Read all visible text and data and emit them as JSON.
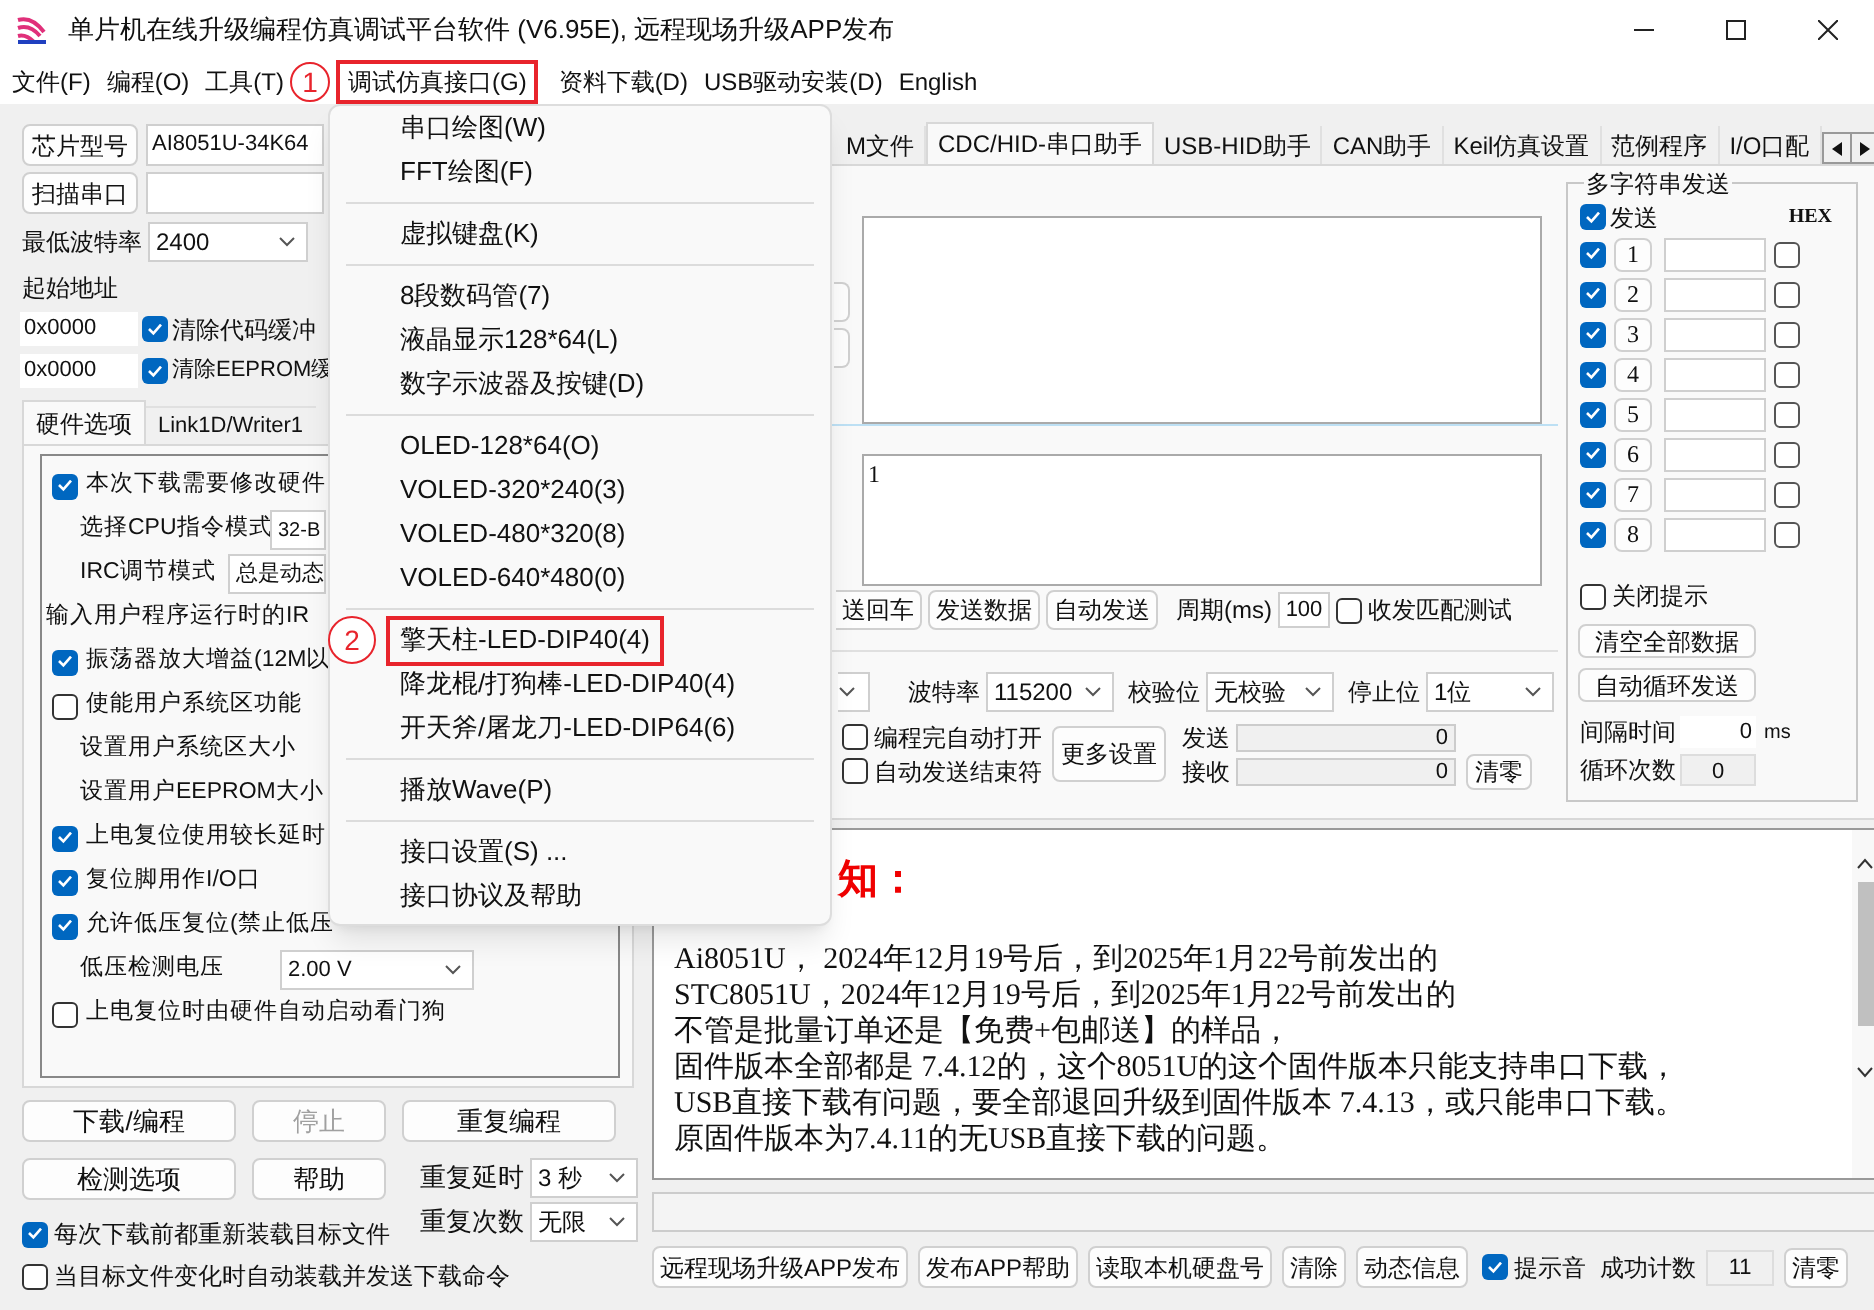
{
  "window": {
    "title": "单片机在线升级编程仿真调试平台软件 (V6.95E), 远程现场升级APP发布"
  },
  "menu_bar": [
    {
      "label": "文件(F)",
      "selected": false
    },
    {
      "label": "编程(O)",
      "selected": false
    },
    {
      "label": "工具(T)",
      "selected": false
    },
    {
      "label": "调试仿真接口(G)",
      "selected": true
    },
    {
      "label": "资料下载(D)",
      "selected": false
    },
    {
      "label": "USB驱动安装(D)",
      "selected": false
    },
    {
      "label": "English",
      "selected": false
    }
  ],
  "annotations": [
    {
      "label": "1"
    },
    {
      "label": "2"
    }
  ],
  "dropdown_menu": [
    [
      {
        "label": "串口绘图(W)",
        "marked": false
      },
      {
        "label": "FFT绘图(F)",
        "marked": false
      }
    ],
    [
      {
        "label": "虚拟键盘(K)",
        "marked": false
      }
    ],
    [
      {
        "label": "8段数码管(7)",
        "marked": false
      },
      {
        "label": "液晶显示128*64(L)",
        "marked": false
      },
      {
        "label": "数字示波器及按键(D)",
        "marked": false
      }
    ],
    [
      {
        "label": "OLED-128*64(O)",
        "marked": false
      },
      {
        "label": "VOLED-320*240(3)",
        "marked": false
      },
      {
        "label": "VOLED-480*320(8)",
        "marked": false
      },
      {
        "label": "VOLED-640*480(0)",
        "marked": false
      }
    ],
    [
      {
        "label": "擎天柱-LED-DIP40(4)",
        "marked": true
      },
      {
        "label": "降龙棍/打狗棒-LED-DIP40(4)",
        "marked": false
      },
      {
        "label": "开天斧/屠龙刀-LED-DIP64(6)",
        "marked": false
      }
    ],
    [
      {
        "label": "播放Wave(P)",
        "marked": false
      }
    ],
    [
      {
        "label": "接口设置(S) ...",
        "marked": false
      },
      {
        "label": "接口协议及帮助",
        "marked": false
      }
    ]
  ],
  "chip": {
    "button": "芯片型号",
    "value": "AI8051U-34K64"
  },
  "scan_button": "扫描串口",
  "min_baud": {
    "label": "最低波特率",
    "value": "2400"
  },
  "start_address": {
    "label": "起始地址",
    "rows": [
      {
        "value": "0x0000",
        "label": "清除代码缓冲",
        "checked": true
      },
      {
        "value": "0x0000",
        "label": "清除EEPROM缓",
        "checked": true
      }
    ]
  },
  "option_tabs": [
    {
      "label": "硬件选项",
      "selected": true
    },
    {
      "label": "Link1D/Writer1",
      "selected": false
    }
  ],
  "hardware_options": [
    {
      "kind": "check",
      "label": "本次下载需要修改硬件",
      "checked": true
    },
    {
      "kind": "select",
      "label": "选择CPU指令模式",
      "value": "32-B"
    },
    {
      "kind": "select",
      "label": "IRC调节模式",
      "value": "总是动态"
    },
    {
      "kind": "heading",
      "label": "输入用户程序运行时的IR"
    },
    {
      "kind": "check",
      "label": "振荡器放大增益(12M以",
      "checked": true
    },
    {
      "kind": "check",
      "label": "使能用户系统区功能",
      "checked": false
    },
    {
      "kind": "setting",
      "label": "设置用户系统区大小"
    },
    {
      "kind": "setting",
      "label": "设置用户EEPROM大小"
    },
    {
      "kind": "check",
      "label": "上电复位使用较长延时",
      "checked": true
    },
    {
      "kind": "check",
      "label": "复位脚用作I/O口",
      "checked": true
    },
    {
      "kind": "check",
      "label": "允许低压复位(禁止低压",
      "checked": true
    },
    {
      "kind": "select",
      "label": "低压检测电压",
      "value": "2.00 V"
    },
    {
      "kind": "check",
      "label": "上电复位时由硬件自动启动看门狗",
      "checked": false
    }
  ],
  "actions": [
    {
      "label": "下载/编程",
      "disabled": false
    },
    {
      "label": "停止",
      "disabled": true
    },
    {
      "label": "重复编程",
      "disabled": false
    },
    {
      "label": "检测选项",
      "disabled": false
    },
    {
      "label": "帮助",
      "disabled": false
    }
  ],
  "repeat": [
    {
      "label": "重复延时",
      "value": "3 秒"
    },
    {
      "label": "重复次数",
      "value": "无限"
    }
  ],
  "load_options": [
    {
      "label": "每次下载前都重新装载目标文件",
      "checked": true
    },
    {
      "label": "当目标文件变化时自动装载并发送下载命令",
      "checked": false
    }
  ],
  "tool_tabs": [
    {
      "label": "M文件",
      "selected": false
    },
    {
      "label": "CDC/HID-串口助手",
      "selected": true
    },
    {
      "label": "USB-HID助手",
      "selected": false
    },
    {
      "label": "CAN助手",
      "selected": false
    },
    {
      "label": "Keil仿真设置",
      "selected": false
    },
    {
      "label": "范例程序",
      "selected": false
    },
    {
      "label": "I/O口配",
      "selected": false
    }
  ],
  "send_text": "1",
  "send_buttons": [
    "送回车",
    "发送数据",
    "自动发送"
  ],
  "period": {
    "label": "周期(ms)",
    "value": "100"
  },
  "match_test": {
    "label": "收发匹配测试",
    "checked": false
  },
  "port_settings": [
    {
      "label": "波特率",
      "value": "115200"
    },
    {
      "label": "校验位",
      "value": "无校验"
    },
    {
      "label": "停止位",
      "value": "1位"
    }
  ],
  "auto_options": [
    {
      "label": "编程完自动打开",
      "checked": false
    },
    {
      "label": "自动发送结束符",
      "checked": false
    }
  ],
  "more_button": "更多设置",
  "counters": [
    {
      "label": "发送",
      "value": "0"
    },
    {
      "label": "接收",
      "value": "0"
    }
  ],
  "clear_button": "清零",
  "multi_send": {
    "title": "多字符串发送",
    "send_all": {
      "label": "发送",
      "checked": true
    },
    "hex_label": "HEX",
    "rows": [
      {
        "number": "1",
        "checked": true,
        "hex": false
      },
      {
        "number": "2",
        "checked": true,
        "hex": false
      },
      {
        "number": "3",
        "checked": true,
        "hex": false
      },
      {
        "number": "4",
        "checked": true,
        "hex": false
      },
      {
        "number": "5",
        "checked": true,
        "hex": false
      },
      {
        "number": "6",
        "checked": true,
        "hex": false
      },
      {
        "number": "7",
        "checked": true,
        "hex": false
      },
      {
        "number": "8",
        "checked": true,
        "hex": false
      }
    ],
    "close_tips": {
      "label": "关闭提示",
      "checked": false
    },
    "buttons": [
      "清空全部数据",
      "自动循环发送"
    ],
    "interval": {
      "label": "间隔时间",
      "value": "0",
      "unit": "ms"
    },
    "loop_count": {
      "label": "循环次数",
      "value": "0"
    }
  },
  "notice": {
    "heading": "知：",
    "lines": [
      "Ai8051U，  2024年12月19号后，到2025年1月22号前发出的",
      "STC8051U，2024年12月19号后，到2025年1月22号前发出的",
      "不管是批量订单还是【免费+包邮送】的样品，",
      "固件版本全部都是 7.4.12的，这个8051U的这个固件版本只能支持串口下载，",
      "USB直接下载有问题，要全部退回升级到固件版本 7.4.13，或只能串口下载。",
      "原固件版本为7.4.11的无USB直接下载的问题。"
    ]
  },
  "bottom_buttons": [
    "远程现场升级APP发布",
    "发布APP帮助",
    "读取本机硬盘号",
    "清除",
    "动态信息"
  ],
  "beep": {
    "label": "提示音",
    "checked": true
  },
  "success": {
    "label": "成功计数",
    "value": "11"
  },
  "reset_button": "清零"
}
